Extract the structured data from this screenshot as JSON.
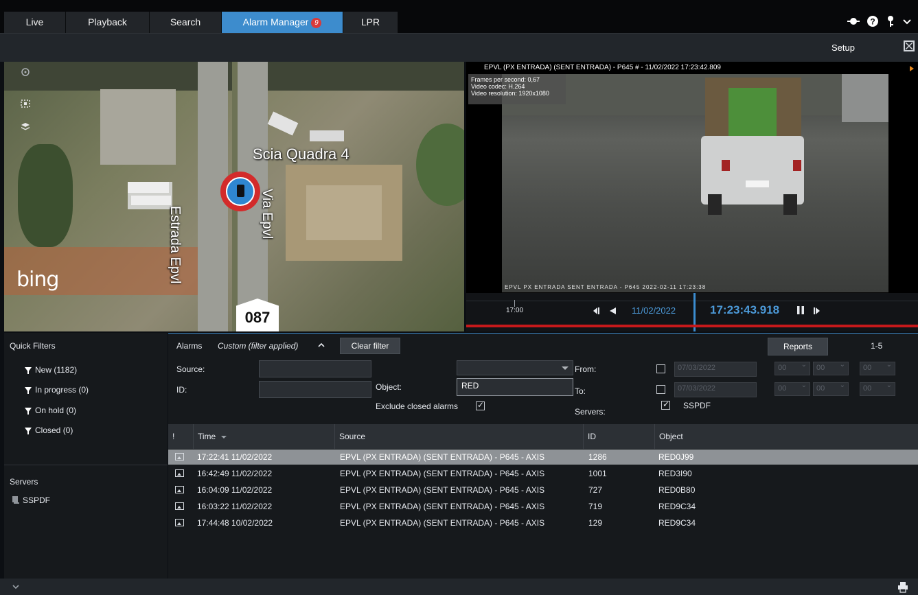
{
  "tabs": [
    {
      "label": "Live"
    },
    {
      "label": "Playback"
    },
    {
      "label": "Search"
    },
    {
      "label": "Alarm Manager",
      "badge": "9",
      "active": true
    },
    {
      "label": "LPR"
    }
  ],
  "toolbar": {
    "setup_label": "Setup"
  },
  "map": {
    "place_label": "Scia Quadra 4",
    "road_label_1": "Estrada Epvl",
    "road_label_2": "Via Epvl",
    "route_number": "087",
    "provider": "bing"
  },
  "video": {
    "title": "EPVL (PX ENTRADA) (SENT ENTRADA) - P645 # - 11/02/2022 17:23:42.809",
    "stats": [
      "Frames per second: 0,67",
      "Video codec: H.264",
      "Video resolution: 1920x1080"
    ],
    "frame_timestamp": "EPVL PX ENTRADA SENT ENTRADA - P645 2022-02-11 17:23:38",
    "timeline_hour": "17:00",
    "date": "11/02/2022",
    "time": "17:23:43.918"
  },
  "quick_filters": {
    "title": "Quick Filters",
    "items": [
      {
        "label": "New (1182)"
      },
      {
        "label": "In progress (0)"
      },
      {
        "label": "On hold (0)"
      },
      {
        "label": "Closed (0)"
      }
    ]
  },
  "servers_panel": {
    "title": "Servers",
    "items": [
      {
        "label": "SSPDF"
      }
    ]
  },
  "alarms": {
    "title": "Alarms",
    "filter_status": "Custom (filter applied)",
    "clear_filter_label": "Clear filter",
    "reports_label": "Reports",
    "range": "1-5",
    "filter": {
      "source_label": "Source:",
      "id_label": "ID:",
      "object_label": "Object:",
      "object_value": "RED",
      "exclude_closed_label": "Exclude closed alarms",
      "exclude_closed_checked": true,
      "from_label": "From:",
      "to_label": "To:",
      "from_date": "07/03/2022",
      "to_date": "07/03/2022",
      "time_placeholder": "00",
      "servers_label": "Servers:",
      "server_value": "SSPDF",
      "server_checked": true
    },
    "columns": [
      {
        "label": "!"
      },
      {
        "label": "Time"
      },
      {
        "label": "Source"
      },
      {
        "label": "ID"
      },
      {
        "label": "Object"
      }
    ],
    "rows": [
      {
        "time": "17:22:41 11/02/2022",
        "source": "EPVL (PX ENTRADA) (SENT ENTRADA) - P645 - AXIS",
        "id": "1286",
        "object": "RED0J99",
        "selected": true
      },
      {
        "time": "16:42:49 11/02/2022",
        "source": "EPVL (PX ENTRADA) (SENT ENTRADA) - P645 - AXIS",
        "id": "1001",
        "object": "RED3I90"
      },
      {
        "time": "16:04:09 11/02/2022",
        "source": "EPVL (PX ENTRADA) (SENT ENTRADA) - P645 - AXIS",
        "id": "727",
        "object": "RED0B80"
      },
      {
        "time": "16:03:22 11/02/2022",
        "source": "EPVL (PX ENTRADA) (SENT ENTRADA) - P645 - AXIS",
        "id": "719",
        "object": "RED9C34"
      },
      {
        "time": "17:44:48 10/02/2022",
        "source": "EPVL (PX ENTRADA) (SENT ENTRADA) - P645 - AXIS",
        "id": "129",
        "object": "RED9C34"
      }
    ]
  },
  "colors": {
    "accent": "#3d8ccd",
    "alert_red": "#c7191b",
    "panel_bg": "#16191c"
  }
}
